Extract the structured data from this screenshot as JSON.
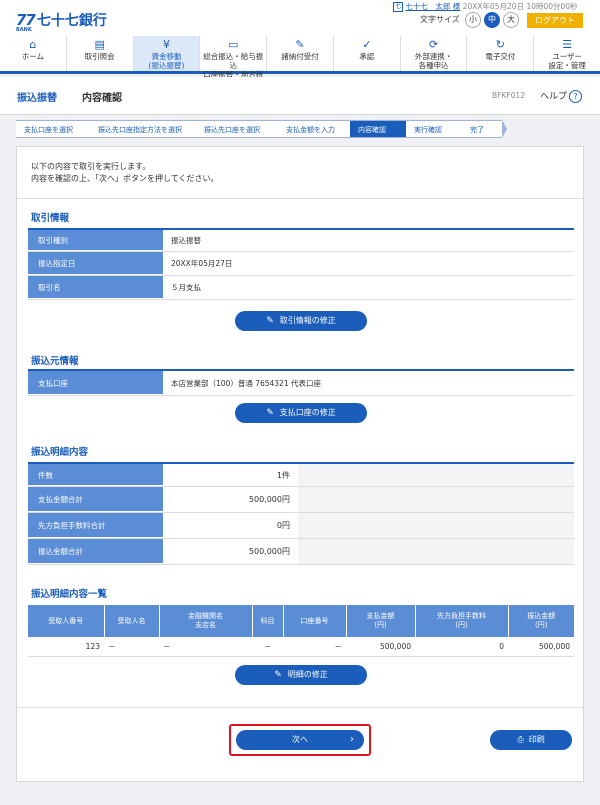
{
  "header": {
    "logo_num": "77",
    "logo_sub": "BANK",
    "logo_name": "七十七銀行",
    "user_icon": "七",
    "user_name": "七十七　太郎 様",
    "datetime": "20XX年05月20日 10時00分00秒",
    "font_size_label": "文字サイズ",
    "font_sizes": [
      "小",
      "中",
      "大"
    ],
    "logout": "ログアウト"
  },
  "nav": {
    "items": [
      {
        "icon": "home-icon",
        "label": "ホーム"
      },
      {
        "icon": "document-icon",
        "label": "取引照会"
      },
      {
        "icon": "yen-transfer-icon",
        "label": "資金移動\n(振込振替)"
      },
      {
        "icon": "monitor-icon",
        "label": "総合振込・給与振込\n口座振替・地方税"
      },
      {
        "icon": "payment-icon",
        "label": "諸納付受付"
      },
      {
        "icon": "approve-icon",
        "label": "承認"
      },
      {
        "icon": "link-icon",
        "label": "外部連携・\n各種申込"
      },
      {
        "icon": "refresh-icon",
        "label": "電子交付"
      },
      {
        "icon": "settings-icon",
        "label": "ユーザー\n設定・管理"
      }
    ]
  },
  "title": {
    "main": "振込振替",
    "sub": "内容確認",
    "screen_code": "BFKF012",
    "help": "ヘルプ"
  },
  "steps": [
    "支払口座を選択",
    "振込先口座指定方法を選択",
    "振込先口座を選択",
    "支払金額を入力",
    "内容確認",
    "実行確認",
    "完了"
  ],
  "intro": {
    "line1": "以下の内容で取引を実行します。",
    "line2": "内容を確認の上、「次へ」ボタンを押してください。"
  },
  "transaction_info": {
    "title": "取引情報",
    "rows": [
      {
        "label": "取引種別",
        "value": "振込振替"
      },
      {
        "label": "振込指定日",
        "value": "20XX年05月27日"
      },
      {
        "label": "取引名",
        "value": "５月支払"
      }
    ],
    "edit_button": "取引情報の修正"
  },
  "source_info": {
    "title": "振込元情報",
    "rows": [
      {
        "label": "支払口座",
        "value": "本店営業部（100）普通 7654321 代表口座"
      }
    ],
    "edit_button": "支払口座の修正"
  },
  "detail_summary": {
    "title": "振込明細内容",
    "rows": [
      {
        "label": "件数",
        "value": "1件"
      },
      {
        "label": "支払金額合計",
        "value": "500,000円"
      },
      {
        "label": "先方負担手数料合計",
        "value": "0円"
      },
      {
        "label": "振込金額合計",
        "value": "500,000円"
      }
    ]
  },
  "detail_list": {
    "title": "振込明細内容一覧",
    "headers": [
      "受取人番号",
      "受取人名",
      "金融機関名\n支店名",
      "科目",
      "口座番号",
      "支払金額\n(円)",
      "先方負担手数料\n(円)",
      "振込金額\n(円)"
    ],
    "rows": [
      [
        "123",
        "－",
        "－",
        "－",
        "－",
        "500,000",
        "0",
        "500,000"
      ]
    ],
    "edit_button": "明細の修正"
  },
  "actions": {
    "next": "次へ",
    "print": "印刷"
  },
  "colors": {
    "primary": "#1a5dbb",
    "label_bg": "#5b8cd6",
    "logout": "#f0b000",
    "highlight": "#e0141e"
  }
}
